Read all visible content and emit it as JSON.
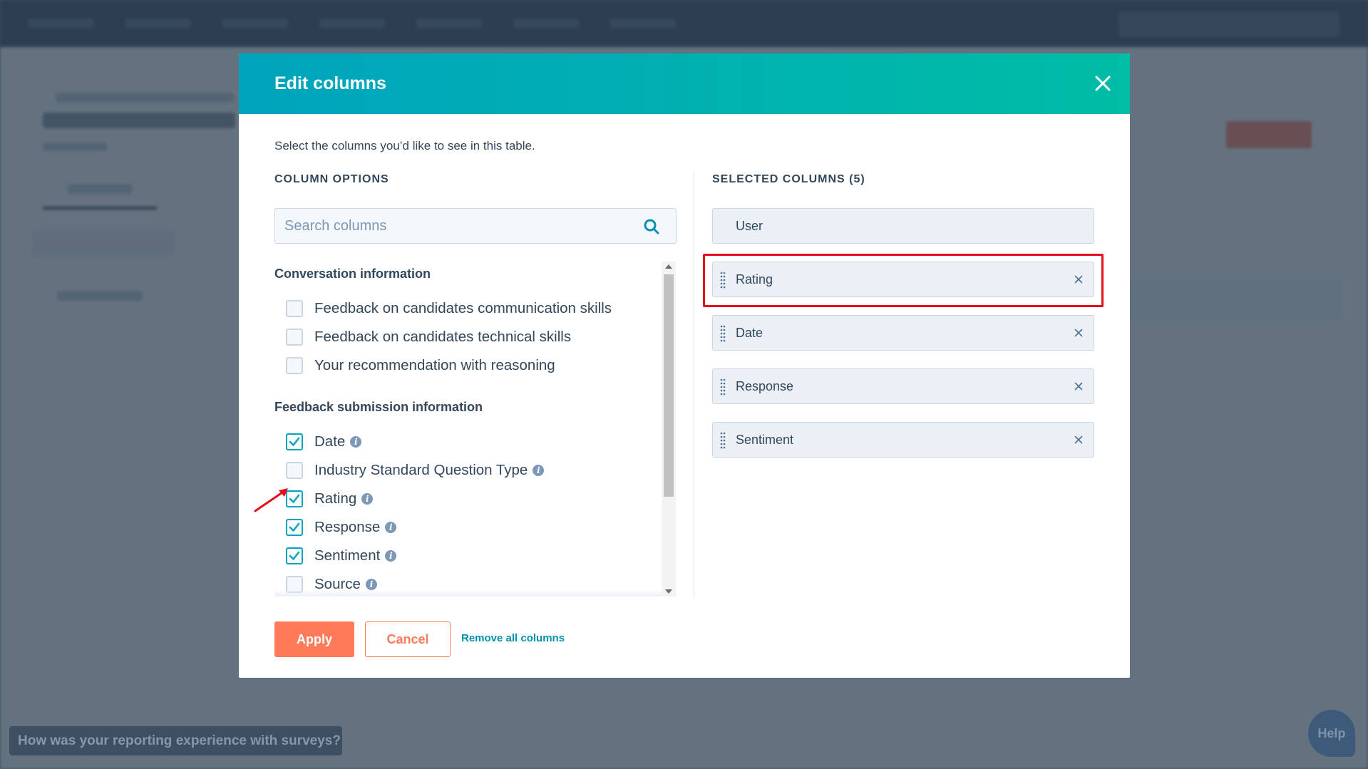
{
  "modal": {
    "title": "Edit columns",
    "description": "Select the columns you’d like to see in this table.",
    "column_options_heading": "COLUMN OPTIONS",
    "selected_columns_heading": "SELECTED COLUMNS (5)",
    "search": {
      "placeholder": "Search columns",
      "value": ""
    },
    "groups": [
      {
        "heading": "Conversation information",
        "options": [
          {
            "label": "Feedback on candidates communication skills",
            "checked": false,
            "info": false
          },
          {
            "label": "Feedback on candidates technical skills",
            "checked": false,
            "info": false
          },
          {
            "label": "Your recommendation with reasoning",
            "checked": false,
            "info": false
          }
        ]
      },
      {
        "heading": "Feedback submission information",
        "options": [
          {
            "label": "Date",
            "checked": true,
            "info": true
          },
          {
            "label": "Industry Standard Question Type",
            "checked": false,
            "info": true
          },
          {
            "label": "Rating",
            "checked": true,
            "info": true
          },
          {
            "label": "Response",
            "checked": true,
            "info": true
          },
          {
            "label": "Sentiment",
            "checked": true,
            "info": true
          },
          {
            "label": "Source",
            "checked": false,
            "info": true
          }
        ]
      }
    ],
    "selected": [
      {
        "label": "User",
        "removable": false
      },
      {
        "label": "Rating",
        "removable": true
      },
      {
        "label": "Date",
        "removable": true
      },
      {
        "label": "Response",
        "removable": true
      },
      {
        "label": "Sentiment",
        "removable": true
      }
    ],
    "apply_label": "Apply",
    "cancel_label": "Cancel",
    "remove_all_label": "Remove all columns"
  },
  "survey_prompt": "How was your reporting experience with surveys?",
  "help_label": "Help",
  "icons": {
    "close": "close-icon",
    "search": "search-icon",
    "info": "info-icon",
    "drag": "drag-handle-icon",
    "remove": "remove-x-icon"
  },
  "colors": {
    "header_start": "#00a4bd",
    "header_end": "#00bda5",
    "primary": "#ff7a59",
    "checkbox_checked": "#00a4bd",
    "link": "#0091ae",
    "highlight": "#e3101e"
  }
}
